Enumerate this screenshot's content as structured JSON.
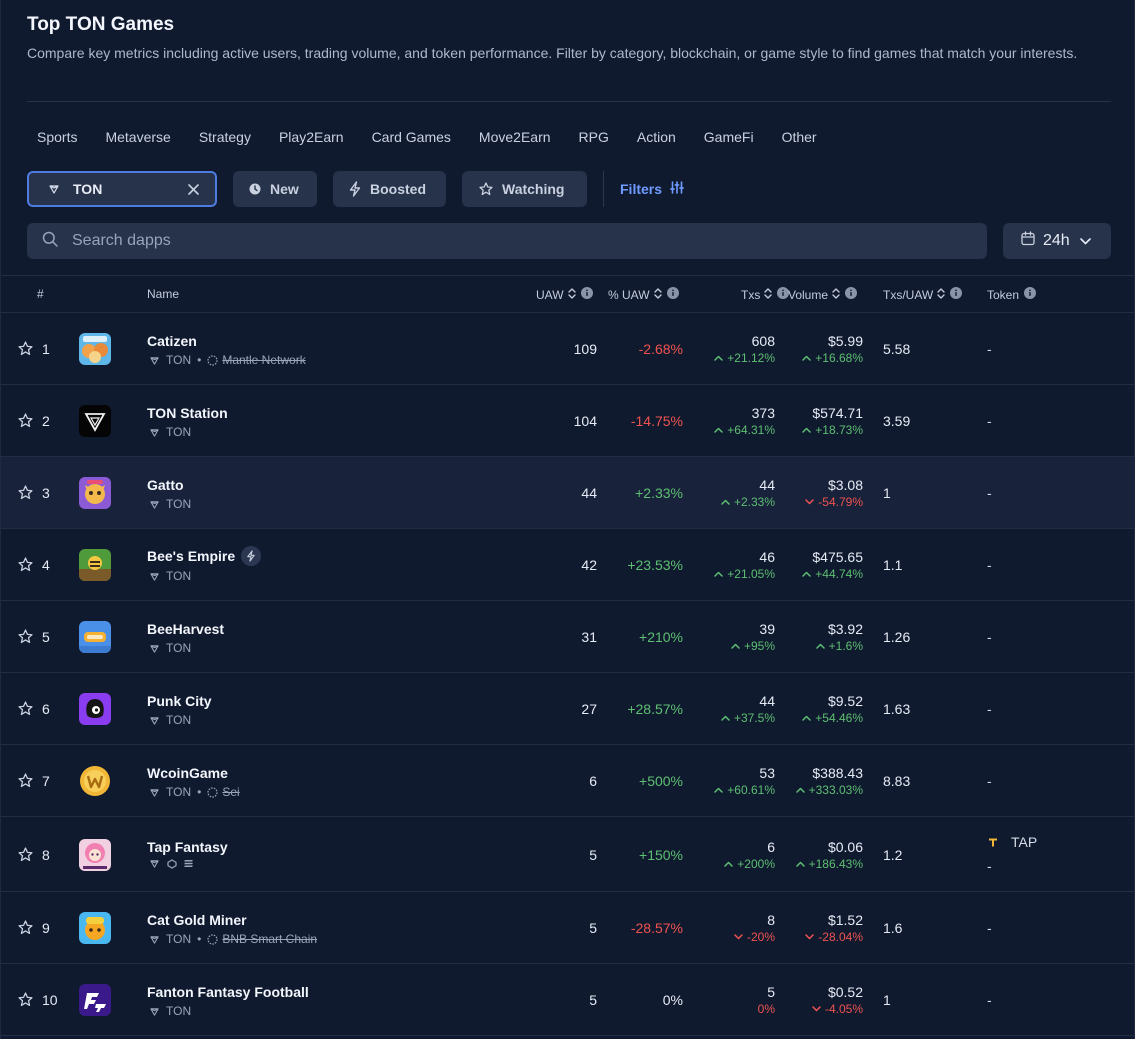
{
  "header": {
    "title": "Top TON Games",
    "subtitle": "Compare key metrics including active users, trading volume, and token performance. Filter by category, blockchain, or game style to find games that match your interests."
  },
  "categories": [
    "Sports",
    "Metaverse",
    "Strategy",
    "Play2Earn",
    "Card Games",
    "Move2Earn",
    "RPG",
    "Action",
    "GameFi",
    "Other"
  ],
  "filters": {
    "chain_chip": "TON",
    "new_label": "New",
    "boosted_label": "Boosted",
    "watching_label": "Watching",
    "filters_label": "Filters"
  },
  "search": {
    "placeholder": "Search dapps"
  },
  "period": {
    "value": "24h"
  },
  "table": {
    "headers": {
      "rank": "#",
      "name": "Name",
      "uaw": "UAW",
      "puaw": "% UAW",
      "txs": "Txs",
      "volume": "Volume",
      "ratio": "Txs/UAW",
      "token": "Token"
    },
    "rows": [
      {
        "rank": "1",
        "name": "Catizen",
        "chain": "TON",
        "extra_chain": "Mantle Network",
        "uaw": "109",
        "puaw": "-2.68%",
        "puaw_dir": "neg",
        "txs": "608",
        "txs_change": "+21.12%",
        "txs_dir": "pos",
        "volume": "$5.99",
        "volume_change": "+16.68%",
        "volume_dir": "pos",
        "ratio": "5.58",
        "token": "-",
        "logo": "catizen"
      },
      {
        "rank": "2",
        "name": "TON Station",
        "chain": "TON",
        "uaw": "104",
        "puaw": "-14.75%",
        "puaw_dir": "neg",
        "txs": "373",
        "txs_change": "+64.31%",
        "txs_dir": "pos",
        "volume": "$574.71",
        "volume_change": "+18.73%",
        "volume_dir": "pos",
        "ratio": "3.59",
        "token": "-",
        "logo": "tonstation"
      },
      {
        "rank": "3",
        "name": "Gatto",
        "chain": "TON",
        "uaw": "44",
        "puaw": "+2.33%",
        "puaw_dir": "pos",
        "txs": "44",
        "txs_change": "+2.33%",
        "txs_dir": "pos",
        "volume": "$3.08",
        "volume_change": "-54.79%",
        "volume_dir": "neg",
        "ratio": "1",
        "token": "-",
        "logo": "gatto"
      },
      {
        "rank": "4",
        "name": "Bee's Empire",
        "chain": "TON",
        "boosted": true,
        "uaw": "42",
        "puaw": "+23.53%",
        "puaw_dir": "pos",
        "txs": "46",
        "txs_change": "+21.05%",
        "txs_dir": "pos",
        "volume": "$475.65",
        "volume_change": "+44.74%",
        "volume_dir": "pos",
        "ratio": "1.1",
        "token": "-",
        "logo": "bees"
      },
      {
        "rank": "5",
        "name": "BeeHarvest",
        "chain": "TON",
        "uaw": "31",
        "puaw": "+210%",
        "puaw_dir": "pos",
        "txs": "39",
        "txs_change": "+95%",
        "txs_dir": "pos",
        "volume": "$3.92",
        "volume_change": "+1.6%",
        "volume_dir": "pos",
        "ratio": "1.26",
        "token": "-",
        "logo": "beeharvest"
      },
      {
        "rank": "6",
        "name": "Punk City",
        "chain": "TON",
        "uaw": "27",
        "puaw": "+28.57%",
        "puaw_dir": "pos",
        "txs": "44",
        "txs_change": "+37.5%",
        "txs_dir": "pos",
        "volume": "$9.52",
        "volume_change": "+54.46%",
        "volume_dir": "pos",
        "ratio": "1.63",
        "token": "-",
        "logo": "punk"
      },
      {
        "rank": "7",
        "name": "WcoinGame",
        "chain": "TON",
        "extra_chain": "Sei",
        "uaw": "6",
        "puaw": "+500%",
        "puaw_dir": "pos",
        "txs": "53",
        "txs_change": "+60.61%",
        "txs_dir": "pos",
        "volume": "$388.43",
        "volume_change": "+333.03%",
        "volume_dir": "pos",
        "ratio": "8.83",
        "token": "-",
        "logo": "wcoin"
      },
      {
        "rank": "8",
        "name": "Tap Fantasy",
        "chain": "",
        "uaw": "5",
        "puaw": "+150%",
        "puaw_dir": "pos",
        "txs": "6",
        "txs_change": "+200%",
        "txs_dir": "pos",
        "volume": "$0.06",
        "volume_change": "+186.43%",
        "volume_dir": "pos",
        "ratio": "1.2",
        "token": "TAP",
        "token_sub": "-",
        "logo": "tapfantasy"
      },
      {
        "rank": "9",
        "name": "Cat Gold Miner",
        "chain": "TON",
        "extra_chain": "BNB Smart Chain",
        "uaw": "5",
        "puaw": "-28.57%",
        "puaw_dir": "neg",
        "txs": "8",
        "txs_change": "-20%",
        "txs_dir": "neg",
        "volume": "$1.52",
        "volume_change": "-28.04%",
        "volume_dir": "neg",
        "ratio": "1.6",
        "token": "-",
        "logo": "catgold"
      },
      {
        "rank": "10",
        "name": "Fanton Fantasy Football",
        "chain": "TON",
        "uaw": "5",
        "puaw": "0%",
        "puaw_dir": "neu",
        "txs": "5",
        "txs_change": "0%",
        "txs_dir": "zero",
        "volume": "$0.52",
        "volume_change": "-4.05%",
        "volume_dir": "neg",
        "ratio": "1",
        "token": "-",
        "logo": "fanton"
      }
    ]
  },
  "colors": {
    "background": "#101a2f",
    "panel": "#27324b",
    "accent": "#4d7be0",
    "link": "#6f9bff",
    "positive": "#5dbf72",
    "negative": "#ef5350"
  }
}
